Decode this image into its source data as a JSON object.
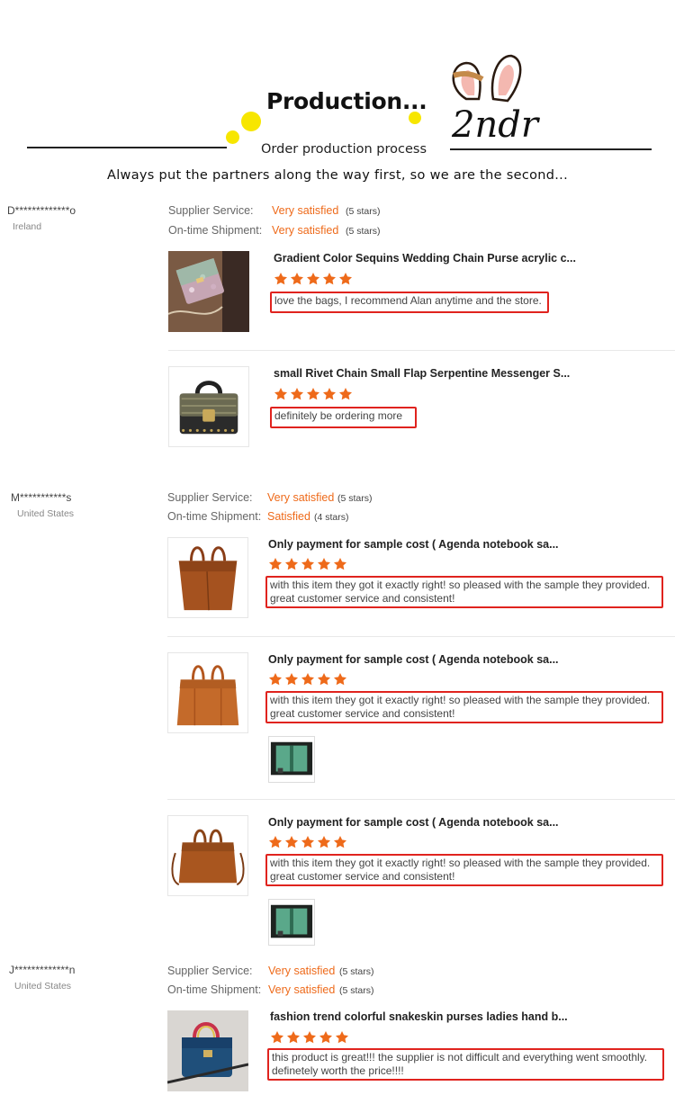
{
  "header": {
    "title": "Production...",
    "subtitle": "Order production process",
    "tagline": "Always put the partners along the way first, so we are the second...",
    "logo_text": "2ndr"
  },
  "colors": {
    "accent": "#ee6a1a",
    "highlight": "#e0231e",
    "dot": "#f7e600"
  },
  "labels": {
    "supplier_service": "Supplier Service:",
    "ontime_shipment": "On-time Shipment:"
  },
  "reviews": [
    {
      "name": "D*************o",
      "country": "Ireland",
      "supplier_rating": "Very satisfied",
      "supplier_stars": "(5 stars)",
      "shipment_rating": "Very satisfied",
      "shipment_stars": "(5 stars)",
      "items": [
        {
          "title": "Gradient Color Sequins Wedding Chain Purse acrylic c...",
          "stars": 5,
          "comment": "love the bags, I recommend Alan anytime and the store.",
          "image_icon": "sequin-purse-photo"
        },
        {
          "title": "small Rivet Chain Small Flap Serpentine Messenger S...",
          "stars": 5,
          "comment": "definitely be ordering more",
          "image_icon": "rivet-bag-photo"
        }
      ]
    },
    {
      "name": "M***********s",
      "country": "United States",
      "supplier_rating": "Very satisfied",
      "supplier_stars": "(5 stars)",
      "shipment_rating": "Satisfied",
      "shipment_stars": "(4 stars)",
      "items": [
        {
          "title": "Only payment for sample cost ( Agenda notebook sa...",
          "stars": 5,
          "comment": "with this item they got it exactly right! so pleased with the sample they provided. great customer service and consistent!",
          "image_icon": "brown-tote-photo"
        },
        {
          "title": "Only payment for sample cost ( Agenda notebook sa...",
          "stars": 5,
          "comment": "with this item they got it exactly right! so pleased with the sample they provided. great customer service and consistent!",
          "image_icon": "brown-tote-photo"
        },
        {
          "title": "Only payment for sample cost ( Agenda notebook sa...",
          "stars": 5,
          "comment": "with this item they got it exactly right! so pleased with the sample they provided. great customer service and consistent!",
          "image_icon": "brown-tote-photo"
        }
      ]
    },
    {
      "name": "J*************n",
      "country": "United States",
      "supplier_rating": "Very satisfied",
      "supplier_stars": "(5 stars)",
      "shipment_rating": "Very satisfied",
      "shipment_stars": "(5 stars)",
      "items": [
        {
          "title": "fashion trend colorful snakeskin purses ladies hand b...",
          "stars": 5,
          "comment": "this product is great!!! the supplier is not difficult and everything went smoothly. definetely worth the price!!!!",
          "image_icon": "snakeskin-handbag-photo"
        }
      ]
    }
  ]
}
